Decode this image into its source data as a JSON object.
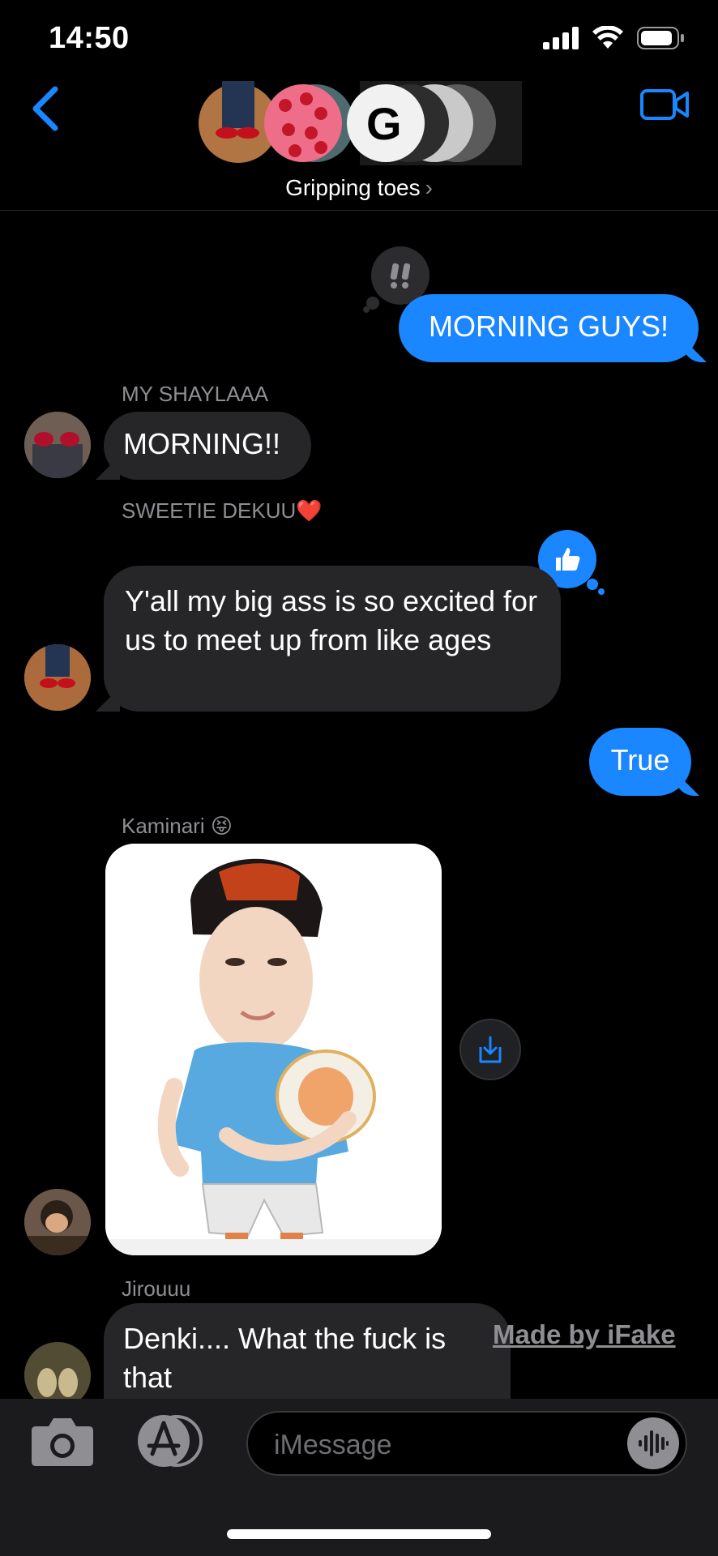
{
  "status_bar": {
    "time": "14:50"
  },
  "header": {
    "group_name": "Gripping toes",
    "chevron": "›",
    "avatar_cluster_letter": "G"
  },
  "messages": [
    {
      "direction": "outgoing",
      "text": "MORNING GUYS!",
      "tapback": "exclamation-tapback-icon"
    },
    {
      "direction": "incoming",
      "sender": "MY SHAYLAAA",
      "text": "MORNING!!"
    },
    {
      "direction": "incoming",
      "sender": "SWEETIE DEKUU❤️",
      "text": "Y'all my big ass is so excited for us to meet up from like ages",
      "tapback": "thumbs-up-tapback-icon"
    },
    {
      "direction": "outgoing",
      "text": "True"
    },
    {
      "direction": "incoming",
      "sender": "Kaminari 😝",
      "type": "image"
    },
    {
      "direction": "incoming",
      "sender": "Jirouuu",
      "text": "Denki.... What the fuck is that"
    }
  ],
  "watermark": "Made by iFake",
  "input": {
    "placeholder": "iMessage"
  },
  "colors": {
    "outgoing_bubble": "#1a86ff",
    "incoming_bubble": "#262629",
    "accent": "#1a86ff",
    "background": "#000000"
  }
}
